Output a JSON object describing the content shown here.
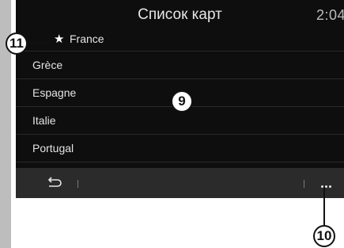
{
  "screen": {
    "title": "Список карт",
    "clock": "2:04"
  },
  "list": {
    "items": [
      {
        "label": "France",
        "favorite": true
      },
      {
        "label": "Grèce",
        "favorite": false
      },
      {
        "label": "Espagne",
        "favorite": false
      },
      {
        "label": "Italie",
        "favorite": false
      },
      {
        "label": "Portugal",
        "favorite": false
      }
    ]
  },
  "toolbar": {
    "back_icon": "back-arrow-icon",
    "more_icon": "more-dots-icon"
  },
  "callouts": {
    "list_area": "9",
    "menu_button": "10",
    "favorite_star": "11"
  },
  "colors": {
    "screen_bg": "#0e0e0e",
    "toolbar_bg": "#2b2b2b",
    "text": "#e4e4e4",
    "left_strip": "#bdbdbd"
  }
}
